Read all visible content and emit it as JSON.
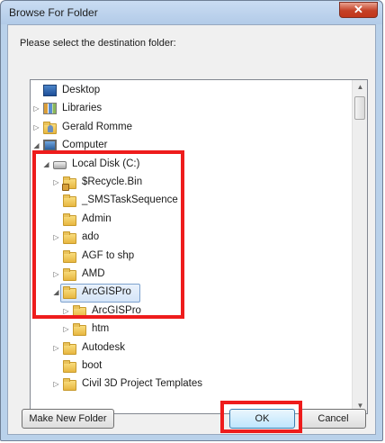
{
  "dialog": {
    "title": "Browse For Folder",
    "close_glyph": "✕",
    "prompt": "Please select the destination folder:"
  },
  "tree": {
    "items": [
      {
        "label": "Desktop",
        "icon": "desktop-icon",
        "expander": "none"
      },
      {
        "label": "Libraries",
        "icon": "libraries-icon",
        "expander": "collapsed"
      },
      {
        "label": "Gerald Romme",
        "icon": "user-folder-icon",
        "expander": "collapsed"
      },
      {
        "label": "Computer",
        "icon": "computer-icon",
        "expander": "expanded"
      },
      {
        "label": "Local Disk (C:)",
        "icon": "drive-icon",
        "expander": "expanded"
      },
      {
        "label": "$Recycle.Bin",
        "icon": "locked-folder-icon",
        "expander": "collapsed"
      },
      {
        "label": "_SMSTaskSequence",
        "icon": "folder-icon",
        "expander": "none"
      },
      {
        "label": "Admin",
        "icon": "folder-icon",
        "expander": "none"
      },
      {
        "label": "ado",
        "icon": "folder-icon",
        "expander": "collapsed"
      },
      {
        "label": "AGF to shp",
        "icon": "folder-icon",
        "expander": "none"
      },
      {
        "label": "AMD",
        "icon": "folder-icon",
        "expander": "collapsed"
      },
      {
        "label": "ArcGISPro",
        "icon": "open-folder-icon",
        "expander": "expanded",
        "selected": true
      },
      {
        "label": "ArcGISPro",
        "icon": "folder-icon",
        "expander": "collapsed"
      },
      {
        "label": "htm",
        "icon": "folder-icon",
        "expander": "collapsed"
      },
      {
        "label": "Autodesk",
        "icon": "folder-icon",
        "expander": "collapsed"
      },
      {
        "label": "boot",
        "icon": "folder-icon",
        "expander": "none"
      },
      {
        "label": "Civil 3D Project Templates",
        "icon": "folder-icon",
        "expander": "collapsed"
      }
    ]
  },
  "buttons": {
    "new_folder": "Make New Folder",
    "ok": "OK",
    "cancel": "Cancel"
  },
  "glyphs": {
    "collapsed": "▷",
    "expanded": "◢",
    "scroll_up": "▲",
    "scroll_down": "▼"
  },
  "colors": {
    "highlight": "#ee1c1c",
    "selection": "#d4e4f7"
  }
}
